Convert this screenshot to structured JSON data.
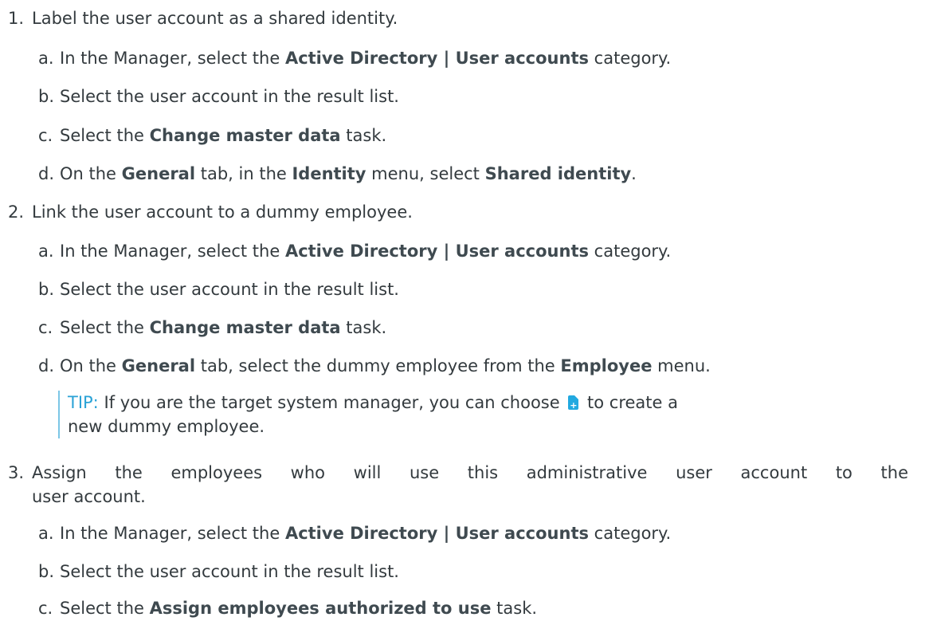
{
  "steps": [
    {
      "num": "1.",
      "text": "Label the user account as a shared identity.",
      "substeps": [
        {
          "letter": "a.",
          "pre": "In the Manager, select the ",
          "bold": "Active Directory | User accounts",
          "post": " category."
        },
        {
          "letter": "b.",
          "text": "Select the user account in the result list."
        },
        {
          "letter": "c.",
          "pre": "Select the ",
          "bold": "Change master data",
          "post": " task."
        },
        {
          "letter": "d.",
          "pre": "On the ",
          "bold1": "General",
          "mid1": " tab, in the ",
          "bold2": "Identity",
          "mid2": " menu, select ",
          "bold3": "Shared identity",
          "post": "."
        }
      ]
    },
    {
      "num": "2.",
      "text": "Link the user account to a dummy employee.",
      "substeps": [
        {
          "letter": "a.",
          "pre": "In the Manager, select the ",
          "bold": "Active Directory | User accounts",
          "post": " category."
        },
        {
          "letter": "b.",
          "text": "Select the user account in the result list."
        },
        {
          "letter": "c.",
          "pre": "Select the ",
          "bold": "Change master data",
          "post": " task."
        },
        {
          "letter": "d.",
          "pre": "On the ",
          "bold1": "General",
          "mid1": " tab, select the dummy employee from the ",
          "bold2": "Employee",
          "post": " menu."
        }
      ],
      "tip": {
        "label": "TIP:",
        "pre": " If you are the target system manager, you can choose ",
        "post": " to create a",
        "line2": "new dummy employee.",
        "icon_glyph": "+"
      }
    },
    {
      "num": "3.",
      "line1": "Assign the employees who will use this administrative user account to the",
      "line2": "user account.",
      "substeps": [
        {
          "letter": "a.",
          "pre": "In the Manager, select the ",
          "bold": "Active Directory | User accounts",
          "post": " category."
        },
        {
          "letter": "b.",
          "text": "Select the user account in the result list."
        },
        {
          "letter": "c.",
          "pre": "Select the ",
          "bold": "Assign employees authorized to use",
          "post": " task."
        }
      ]
    }
  ]
}
